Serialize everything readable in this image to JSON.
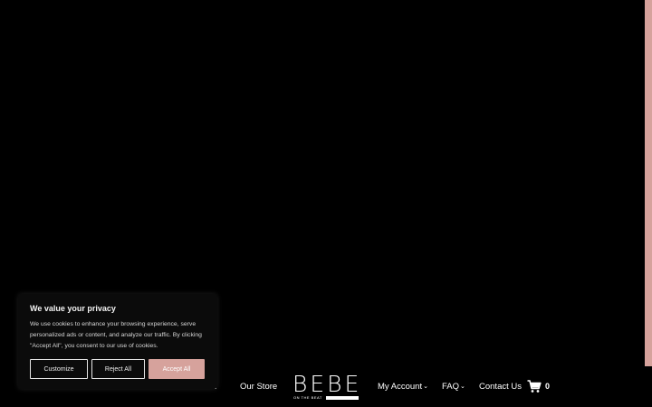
{
  "nav": {
    "partial_item": "w",
    "our_store": "Our Store",
    "logo_main": "BEBE",
    "logo_sub": "ON THE BEAT",
    "my_account": "My Account",
    "faq": "FAQ",
    "contact_us": "Contact Us",
    "cart_count": "0",
    "chevron": "⌄"
  },
  "cookie_banner": {
    "title": "We value your privacy",
    "text": "We use cookies to enhance your browsing experience, serve personalized ads or content, and analyze our traffic. By clicking \"Accept All\", you consent to our use of cookies.",
    "customize_label": "Customize",
    "reject_label": "Reject All",
    "accept_label": "Accept All"
  },
  "colors": {
    "accent": "#d6a29c",
    "background": "#000000"
  },
  "icons": {
    "cart": "cart-icon",
    "chevron": "chevron-down-icon"
  }
}
